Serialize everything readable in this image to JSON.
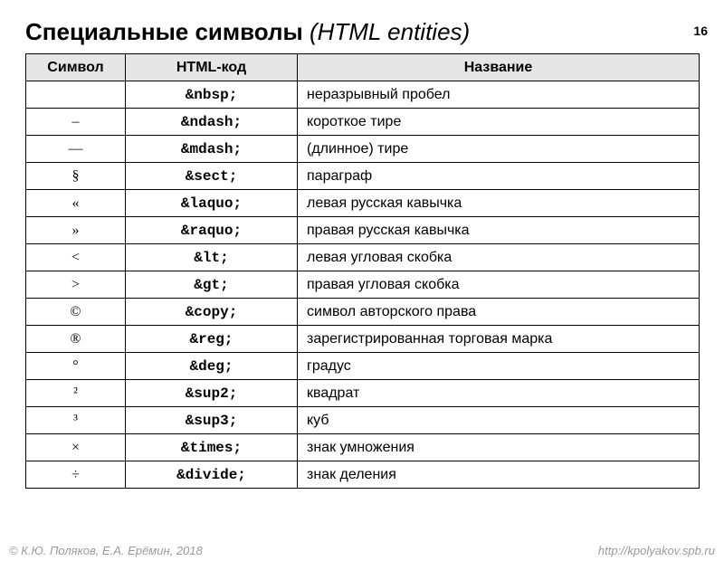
{
  "page_number": "16",
  "title_bold": "Специальные символы",
  "title_rest": " (HTML entities)",
  "headers": {
    "symbol": "Символ",
    "code": "HTML-код",
    "name": "Название"
  },
  "rows": [
    {
      "symbol": " ",
      "code": "&nbsp;",
      "name": "неразрывный пробел"
    },
    {
      "symbol": "–",
      "code": "&ndash;",
      "name": "короткое тире"
    },
    {
      "symbol": "—",
      "code": "&mdash;",
      "name": "(длинное) тире"
    },
    {
      "symbol": "§",
      "code": "&sect;",
      "name": "параграф"
    },
    {
      "symbol": "«",
      "code": "&laquo;",
      "name": "левая русская кавычка"
    },
    {
      "symbol": "»",
      "code": "&raquo;",
      "name": "правая русская кавычка"
    },
    {
      "symbol": "<",
      "code": "&lt;",
      "name": "левая угловая скобка"
    },
    {
      "symbol": ">",
      "code": "&gt;",
      "name": "правая угловая скобка"
    },
    {
      "symbol": "©",
      "code": "&copy;",
      "name": "символ авторского права"
    },
    {
      "symbol": "®",
      "code": "&reg;",
      "name": "зарегистрированная торговая марка"
    },
    {
      "symbol": "°",
      "code": "&deg;",
      "name": "градус"
    },
    {
      "symbol": "²",
      "code": "&sup2;",
      "name": "квадрат"
    },
    {
      "symbol": "³",
      "code": "&sup3;",
      "name": "куб"
    },
    {
      "symbol": "×",
      "code": "&times;",
      "name": "знак умножения"
    },
    {
      "symbol": "÷",
      "code": "&divide;",
      "name": "знак деления"
    }
  ],
  "footer": {
    "left": "© К.Ю. Поляков, Е.А. Ерёмин, 2018",
    "right": "http://kpolyakov.spb.ru"
  }
}
